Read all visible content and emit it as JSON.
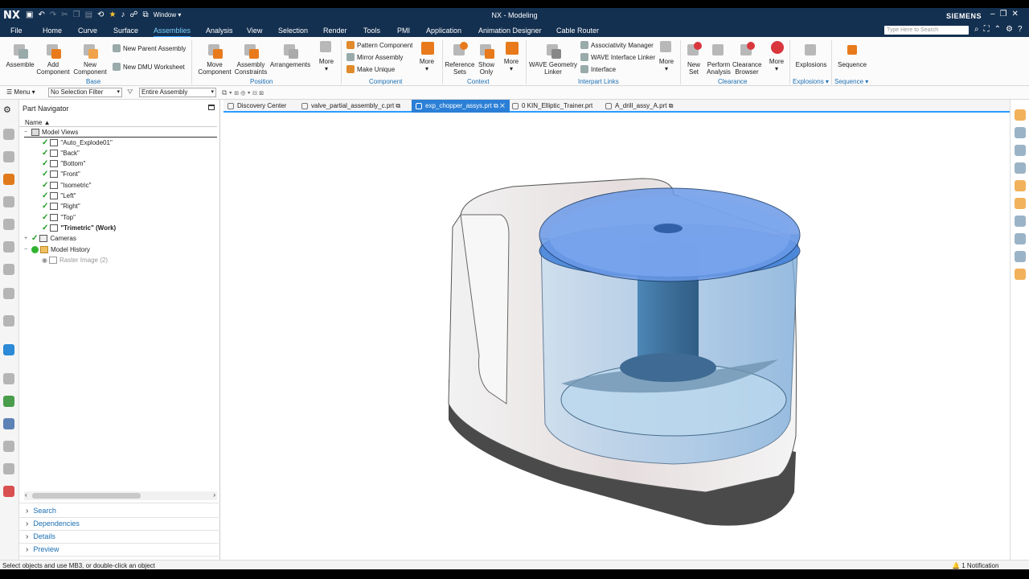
{
  "app": {
    "logo": "NX",
    "title": "NX - Modeling",
    "brand": "SIEMENS",
    "window_menu": "Window"
  },
  "menu": {
    "tabs": [
      "File",
      "Home",
      "Curve",
      "Surface",
      "Assemblies",
      "Analysis",
      "View",
      "Selection",
      "Render",
      "Tools",
      "PMI",
      "Application",
      "Animation Designer",
      "Cable Router"
    ],
    "active": "Assemblies",
    "search_placeholder": "Type Here to Search"
  },
  "ribbon": {
    "assembly": "Assemble",
    "add_component": "Add Component",
    "new_component": "New Component",
    "new_parent": "New Parent Assembly",
    "new_dmu": "New DMU Worksheet",
    "move_component": "Move Component",
    "assembly_constraints": "Assembly Constraints",
    "arrangements": "Arrangements",
    "more": "More",
    "pattern_component": "Pattern Component",
    "mirror_assembly": "Mirror Assembly",
    "make_unique": "Make Unique",
    "reference_sets": "Reference Sets",
    "show_only": "Show Only",
    "wave_geometry_linker": "WAVE Geometry Linker",
    "associativity_manager": "Associativity Manager",
    "wave_interface_linker": "WAVE Interface Linker",
    "interface": "Interface",
    "new_set": "New Set",
    "perform_analysis": "Perform Analysis",
    "clearance_browser": "Clearance Browser",
    "explosions": "Explosions",
    "sequence": "Sequence",
    "groups": {
      "base": "Base",
      "position": "Position",
      "component": "Component",
      "context": "Context",
      "interpart_links": "Interpart Links",
      "clearance": "Clearance",
      "explosions": "Explosions",
      "sequence": "Sequence"
    }
  },
  "filterbar": {
    "menu": "Menu",
    "selection_filter": "No Selection Filter",
    "scope": "Entire Assembly"
  },
  "part_navigator": {
    "title": "Part Navigator",
    "column": "Name",
    "rows": [
      {
        "label": "Model Views",
        "level": 0
      },
      {
        "label": "\"Auto_Explode01\"",
        "level": 1
      },
      {
        "label": "\"Back\"",
        "level": 1
      },
      {
        "label": "\"Bottom\"",
        "level": 1
      },
      {
        "label": "\"Front\"",
        "level": 1
      },
      {
        "label": "\"Isometric\"",
        "level": 1
      },
      {
        "label": "\"Left\"",
        "level": 1
      },
      {
        "label": "\"Right\"",
        "level": 1
      },
      {
        "label": "\"Top\"",
        "level": 1
      },
      {
        "label": "\"Trimetric\" (Work)",
        "level": 1
      },
      {
        "label": "Cameras",
        "level": 0
      },
      {
        "label": "Model History",
        "level": 0
      },
      {
        "label": "Raster Image (2)",
        "level": 1
      }
    ],
    "sections": [
      "Search",
      "Dependencies",
      "Details",
      "Preview"
    ]
  },
  "doc_tabs": [
    "Discovery Center",
    "valve_partial_assembly_c.prt",
    "exp_chopper_assys.prt",
    "0 KIN_Elliptic_Trainer.prt",
    "A_drill_assy_A.prt"
  ],
  "active_doc": "exp_chopper_assys.prt",
  "colors": {
    "titlebar": "#143050",
    "accent": "#2b9cff",
    "active_tab": "#2b7fd6",
    "group_label": "#1b6fb3"
  },
  "status": {
    "hint": "Select objects and use MB3, or double-click an object",
    "notification": "1 Notification"
  }
}
